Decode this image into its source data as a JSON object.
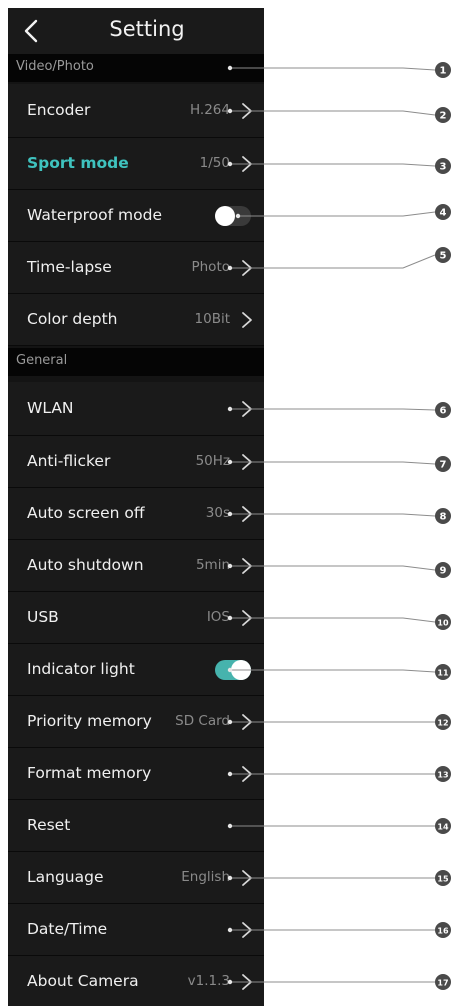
{
  "header": {
    "title": "Setting",
    "back_icon": "chevron-left-icon"
  },
  "sections": [
    {
      "title": "Video/Photo",
      "items": [
        {
          "label": "Encoder",
          "value": "H.264",
          "control": "chevron"
        },
        {
          "label": "Sport mode",
          "value": "1/50",
          "control": "chevron",
          "active": true
        },
        {
          "label": "Waterproof mode",
          "value": "",
          "control": "toggle",
          "on": false
        },
        {
          "label": "Time-lapse",
          "value": "Photo",
          "control": "chevron"
        },
        {
          "label": "Color depth",
          "value": "10Bit",
          "control": "chevron"
        }
      ]
    },
    {
      "title": "General",
      "items": [
        {
          "label": "WLAN",
          "value": "",
          "control": "chevron"
        },
        {
          "label": "Anti-flicker",
          "value": "50Hz",
          "control": "chevron"
        },
        {
          "label": "Auto screen off",
          "value": "30s",
          "control": "chevron"
        },
        {
          "label": "Auto shutdown",
          "value": "5min",
          "control": "chevron"
        },
        {
          "label": "USB",
          "value": "IOS",
          "control": "chevron"
        },
        {
          "label": "Indicator light",
          "value": "",
          "control": "toggle",
          "on": true
        },
        {
          "label": "Priority memory",
          "value": "SD Card",
          "control": "chevron"
        },
        {
          "label": "Format memory",
          "value": "",
          "control": "chevron"
        },
        {
          "label": "Reset",
          "value": "",
          "control": "none"
        },
        {
          "label": "Language",
          "value": "English",
          "control": "chevron"
        },
        {
          "label": "Date/Time",
          "value": "",
          "control": "chevron"
        },
        {
          "label": "About Camera",
          "value": "v1.1.3",
          "control": "chevron"
        }
      ]
    }
  ],
  "callouts": [
    "1",
    "2",
    "3",
    "4",
    "5",
    "6",
    "7",
    "8",
    "9",
    "10",
    "11",
    "12",
    "13",
    "14",
    "15",
    "16",
    "17"
  ],
  "colors": {
    "accent": "#3fc3bf",
    "toggle_on": "#46b3ad",
    "background": "#141414",
    "row": "#1a1a1a"
  }
}
